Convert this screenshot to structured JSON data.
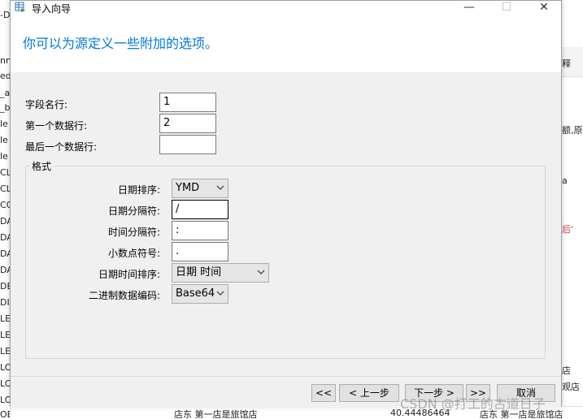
{
  "background": {
    "left_items": [
      "-D",
      "nn",
      "ed",
      "_a",
      "_b",
      "le",
      "le",
      "le",
      "CL",
      "CL",
      "CO",
      "DA",
      "DA",
      "DA",
      "DA",
      "DE",
      "DIR",
      "LE",
      "LE",
      "LE",
      "LO",
      "LO",
      "LO",
      "OB_LOCK"
    ],
    "right_items": [
      "释",
      "额,原",
      "a",
      "后'",
      "店",
      "观店"
    ],
    "bottom_items": [
      "店东 第一店是旅馆店",
      "40.44486464",
      "店东 第一店是旅馆店"
    ]
  },
  "dialog": {
    "title": "导入向导",
    "header_text": "你可以为源定义一些附加的选项。",
    "fields": {
      "field_name_row_label": "字段名行:",
      "field_name_row_value": "1",
      "first_data_row_label": "第一个数据行:",
      "first_data_row_value": "2",
      "last_data_row_label": "最后一个数据行:",
      "last_data_row_value": ""
    },
    "format": {
      "group_label": "格式",
      "date_order_label": "日期排序:",
      "date_order_value": "YMD",
      "date_separator_label": "日期分隔符:",
      "date_separator_value": "/",
      "time_separator_label": "时间分隔符:",
      "time_separator_value": ":",
      "decimal_symbol_label": "小数点符号:",
      "decimal_symbol_value": ".",
      "datetime_order_label": "日期时间排序:",
      "datetime_order_value": "日期 时间",
      "binary_encoding_label": "二进制数据编码:",
      "binary_encoding_value": "Base64"
    },
    "buttons": {
      "first": "<<",
      "prev": "< 上一步",
      "next": "下一步 >",
      "last": ">>",
      "cancel": "取消"
    },
    "window_buttons": {
      "minimize": "—",
      "maximize": "☐",
      "close": "✕"
    }
  },
  "watermark": "CSDN @打工的古道日子",
  "colors": {
    "header_text": "#0078d7",
    "dialog_bg": "#f0f0f0"
  }
}
